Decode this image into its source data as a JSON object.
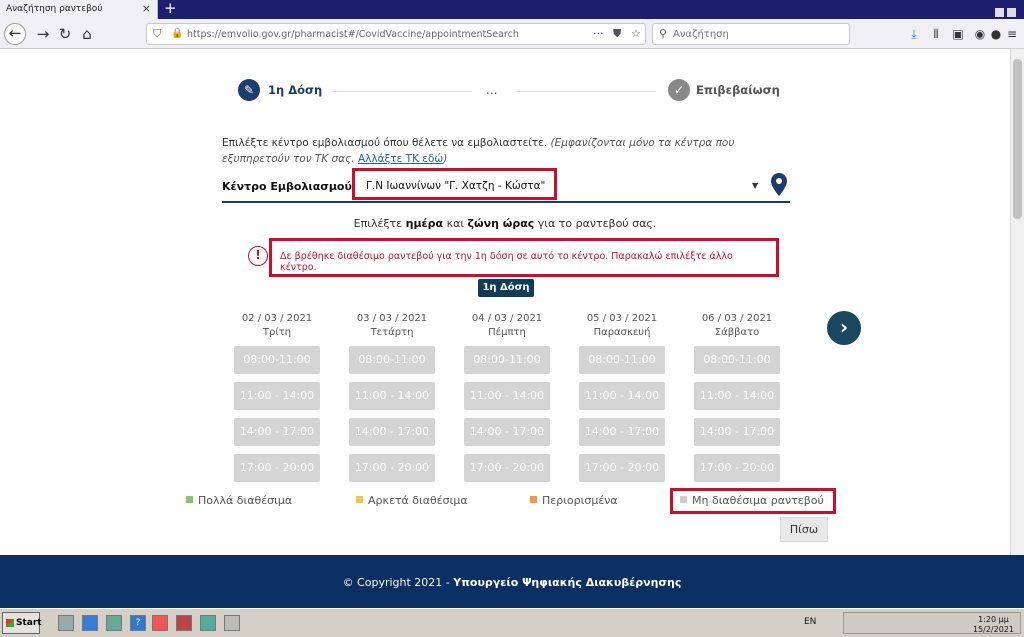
{
  "browser": {
    "tab_title": "Αναζήτηση ραντεβού",
    "tab_close": "×",
    "new_tab": "+",
    "url_host": "https://emvolio.gov.gr",
    "url_path": "/pharmacist#/CovidVaccine/appointmentSearch",
    "search_placeholder": "Αναζήτηση"
  },
  "stepper": {
    "step1_label": "1η Δόση",
    "dots": "...",
    "step2_label": "Επιβεβαίωση"
  },
  "intro": {
    "text": "Επιλέξτε κέντρο εμβολιασμού όπου θέλετε να εμβολιαστείτε. ",
    "note": "(Εμφανίζονται μόνο τα κέντρα που εξυπηρετούν τον ΤΚ σας. ",
    "link": "Αλλάξτε ΤΚ εδώ",
    "note_end": ")"
  },
  "center": {
    "label": "Κέντρο Εμβολιασμού:",
    "selected": "Γ.Ν Ιωαννίνων \"Γ. Χατζη - Κώστα\""
  },
  "choose": {
    "pre": "Επιλέξτε ",
    "bold1": "ημέρα",
    "mid": " και ",
    "bold2": "ζώνη ώρας",
    "post": " για το ραντεβού σας."
  },
  "alert": {
    "icon": "!",
    "message": "Δε βρέθηκε διαθέσιμο ραντεβού για την 1η δόση σε αυτό το κέντρο. Παρακαλώ επιλέξτε άλλο κέντρο."
  },
  "dose_badge": "1η Δόση",
  "days": [
    {
      "date": "02 / 03 / 2021",
      "weekday": "Τρίτη"
    },
    {
      "date": "03 / 03 / 2021",
      "weekday": "Τετάρτη"
    },
    {
      "date": "04 / 03 / 2021",
      "weekday": "Πέμπτη"
    },
    {
      "date": "05 / 03 / 2021",
      "weekday": "Παρασκευή"
    },
    {
      "date": "06 / 03 / 2021",
      "weekday": "Σάββατο"
    }
  ],
  "slots": [
    "08:00-11:00",
    "11:00 - 14:00",
    "14:00 - 17:00",
    "17:00 - 20:00"
  ],
  "next": "›",
  "legend": [
    {
      "label": "Πολλά διαθέσιμα",
      "color": "#8cc56e"
    },
    {
      "label": "Αρκετά διαθέσιμα",
      "color": "#f3c54e"
    },
    {
      "label": "Περιορισμένα",
      "color": "#f09a4a"
    },
    {
      "label": "Μη διαθέσιμα ραντεβού",
      "color": "#cfcfcf"
    }
  ],
  "back_button": "Πίσω",
  "footer": {
    "copyright": "© Copyright 2021 - ",
    "ministry": "Υπουργείο Ψηφιακής Διακυβέρνησης"
  },
  "taskbar": {
    "start": "Start",
    "lang": "EN",
    "time": "1:20 μμ",
    "date": "15/2/2021"
  },
  "colors": {
    "primary": "#1d3b6b",
    "alert": "#c8102e",
    "footer": "#0b2f63",
    "slot_disabled": "#d4d4d4"
  }
}
